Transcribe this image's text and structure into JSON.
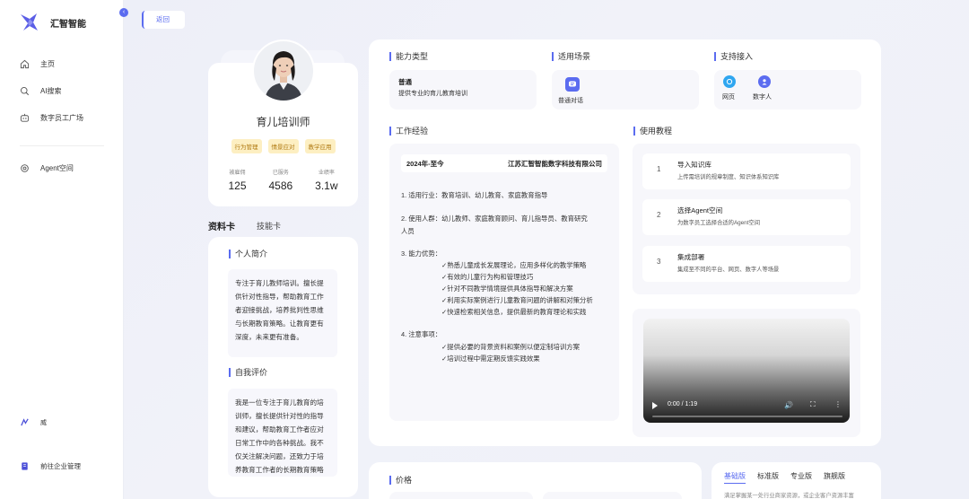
{
  "sidebar": {
    "brand_name": "汇智智能",
    "items": [
      {
        "label": "主页",
        "icon": "home-icon"
      },
      {
        "label": "AI搜索",
        "icon": "search-icon"
      },
      {
        "label": "数字员工广场",
        "icon": "robot-icon"
      },
      {
        "label": "Agent空间",
        "icon": "settings-icon"
      }
    ],
    "user_name": "威",
    "enterprise_label": "前往企业管理"
  },
  "back_label": "返回",
  "profile": {
    "name": "育儿培训师",
    "tags": [
      "行为管理",
      "情景应对",
      "教学应用"
    ],
    "stats": [
      {
        "label": "被雇佣",
        "value": "125"
      },
      {
        "label": "已服务",
        "value": "4586"
      },
      {
        "label": "业绩率",
        "value": "3.1w"
      }
    ]
  },
  "cards_tabs": {
    "active": "资料卡",
    "other": "技能卡"
  },
  "intro": {
    "title": "个人简介",
    "text": "专注于育儿教师培训。擅长提供针对性指导，帮助教育工作者迎接挑战，培养批判性思维与长期教育策略。让教育更有深度，未来更有准备。"
  },
  "self_eval": {
    "title": "自我评价",
    "text": "我是一位专注于育儿教育的培训师，擅长提供针对性的指导和建议，帮助教育工作者应对日常工作中的各种挑战。我不仅关注解决问题，还致力于培养教育工作者的长期教育策略和批判性思维"
  },
  "ability": {
    "title": "能力类型",
    "name": "普通",
    "desc": "提供专业的育儿教育培训"
  },
  "scene": {
    "title": "适用场景",
    "item": "普通对话"
  },
  "access": {
    "title": "支持接入",
    "items": [
      "网页",
      "数字人"
    ]
  },
  "work": {
    "title": "工作经验",
    "period": "2024年-至今",
    "company": "江苏汇智智能数字科技有限公司",
    "industry": "1. 适用行业：教育培训、幼儿教育、家庭教育指导",
    "users_line1": "2. 使用人群：幼儿教师、家庭教育顾问、育儿指导员、教育研究",
    "users_line2": "人员",
    "adv_title": "3. 能力优势：",
    "advantages": [
      "✓熟悉儿童成长发展理论，应用多样化的教学策略",
      "✓有效的儿童行为构和管理技巧",
      "✓针对不同教学情境提供具体指导和解决方案",
      "✓利用实际案例进行儿童教育问题的讲解和对策分析",
      "✓快速检索相关信息，提供最新的教育理论和实践"
    ],
    "notes_title": "4. 注意事项：",
    "notes": [
      "✓提供必要的背景资料和案例以便定制培训方案",
      "✓培训过程中需定期反馈实践效果"
    ]
  },
  "tutorial": {
    "title": "使用教程",
    "steps": [
      {
        "num": "1",
        "title": "导入知识库",
        "desc": "上传需培训的规章制度、知识体系知识库"
      },
      {
        "num": "2",
        "title": "选择Agent空间",
        "desc": "为数字员工选择合适的Agent空间"
      },
      {
        "num": "3",
        "title": "集成部署",
        "desc": "集成至不同的平台、网页、数字人等场景"
      }
    ]
  },
  "video": {
    "time": "0:00 / 1:19",
    "progress": 0
  },
  "price": {
    "title": "价格",
    "tabs": [
      "基础版",
      "标准版",
      "专业版",
      "旗舰版"
    ],
    "active_tab": "基础版",
    "desc": "满足掌握某一处行业商家资源，或企业客户资源丰富"
  },
  "colors": {
    "accent": "#5b6cf0",
    "tag_bg": "#fdefc2",
    "tag_text": "#b07a12"
  }
}
